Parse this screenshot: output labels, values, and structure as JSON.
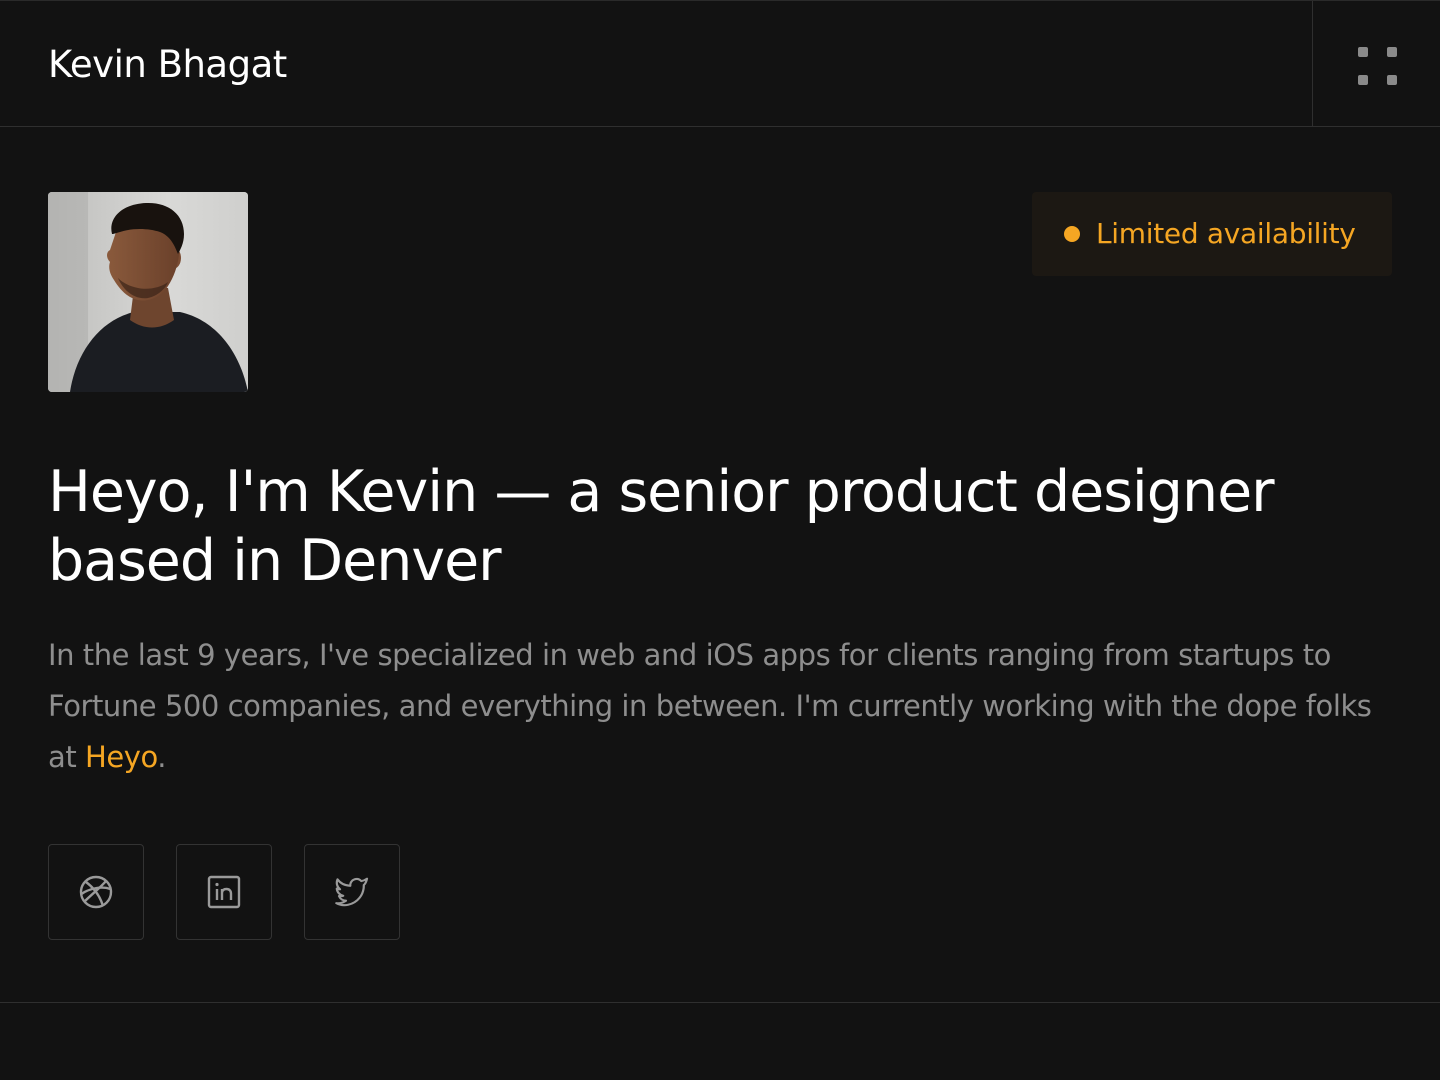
{
  "header": {
    "site_name": "Kevin Bhagat",
    "menu_icon": "grid-menu-icon"
  },
  "hero": {
    "avatar_alt": "Portrait of Kevin",
    "availability": {
      "label": "Limited availability",
      "color": "#f5a623"
    },
    "headline_line1": "Heyo, I'm Kevin — a senior product designer",
    "headline_line2": "based in Denver",
    "bio_text": "In the last 9 years, I've specialized in web and iOS apps for clients ranging from startups to Fortune 500 companies, and everything in between. I'm currently working with the dope folks at ",
    "bio_link": "Heyo",
    "bio_end": "."
  },
  "socials": [
    {
      "name": "Dribbble",
      "icon": "dribbble-icon"
    },
    {
      "name": "LinkedIn",
      "icon": "linkedin-icon"
    },
    {
      "name": "Twitter",
      "icon": "twitter-icon"
    }
  ],
  "colors": {
    "background": "#121212",
    "accent": "#f5a623",
    "text_primary": "#ffffff",
    "text_muted": "#8e8e8e",
    "border": "#2f2f2f"
  }
}
